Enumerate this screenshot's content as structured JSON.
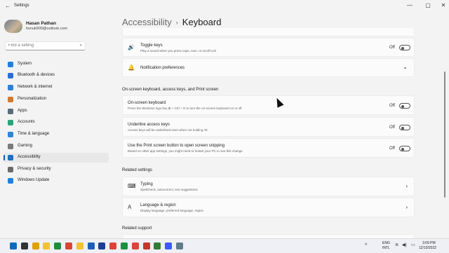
{
  "window": {
    "title": "Settings",
    "back_glyph": "←",
    "minimize_glyph": "—",
    "maximize_glyph": "▢",
    "close_glyph": "✕"
  },
  "user": {
    "name": "Hasan Pathan",
    "email": "hsnuk900@outlook.com"
  },
  "search": {
    "placeholder": "Find a setting",
    "icon": "search-icon"
  },
  "nav": [
    {
      "label": "System",
      "color": "#1f80e0"
    },
    {
      "label": "Bluetooth & devices",
      "color": "#2a6fd6"
    },
    {
      "label": "Network & internet",
      "color": "#2f7fd8"
    },
    {
      "label": "Personalization",
      "color": "#d07a2c"
    },
    {
      "label": "Apps",
      "color": "#5b6b7a"
    },
    {
      "label": "Accounts",
      "color": "#28a37a"
    },
    {
      "label": "Time & language",
      "color": "#2a86d6"
    },
    {
      "label": "Gaming",
      "color": "#7a7a7a"
    },
    {
      "label": "Accessibility",
      "color": "#1d6fbf",
      "active": true
    },
    {
      "label": "Privacy & security",
      "color": "#6a6a6a"
    },
    {
      "label": "Windows Update",
      "color": "#1f80e0"
    }
  ],
  "breadcrumb": {
    "parent": "Accessibility",
    "separator": "›",
    "current": "Keyboard"
  },
  "cards": {
    "toggle_keys": {
      "title": "Toggle keys",
      "desc": "Play a sound when you press caps, num, or scroll lock",
      "state": "Off"
    },
    "notification": {
      "title": "Notification preferences",
      "chevron": "⌄"
    }
  },
  "sections": {
    "onscreen": "On-screen keyboard, access keys, and Print screen",
    "related_settings": "Related settings",
    "related_support": "Related support"
  },
  "onscreen": [
    {
      "title": "On-screen keyboard",
      "desc": "Press the Windows logo key ⊞ + Ctrl + O to turn the on-screen keyboard on or off",
      "state": "Off"
    },
    {
      "title": "Underline access keys",
      "desc": "Access keys will be underlined even when not holding Alt",
      "state": "Off"
    },
    {
      "title": "Use the Print screen button to open screen snipping",
      "desc": "Based on other app settings, you might need to restart your PC to see this change",
      "state": "Off"
    }
  ],
  "related": [
    {
      "title": "Typing",
      "desc": "Spellcheck, autocorrect, text suggestions",
      "chevron": "›"
    },
    {
      "title": "Language & region",
      "desc": "Display language, preferred language, region",
      "chevron": "›"
    }
  ],
  "taskbar": {
    "lang_top": "ENG",
    "lang_bottom": "INTL",
    "time": "3:09 PM",
    "date": "12/10/2022",
    "tray_chevron": "^",
    "apps": [
      "#0f6cbd",
      "#333333",
      "#e0a100",
      "#f2c230",
      "#1e8e3e",
      "#db4437",
      "#f2c230",
      "#1d5fb8",
      "#1d3f8f",
      "#db4437",
      "#1e8e3e",
      "#db4437",
      "#c0392b",
      "#2e7d32",
      "#3d5afe",
      "#607d8b"
    ]
  }
}
